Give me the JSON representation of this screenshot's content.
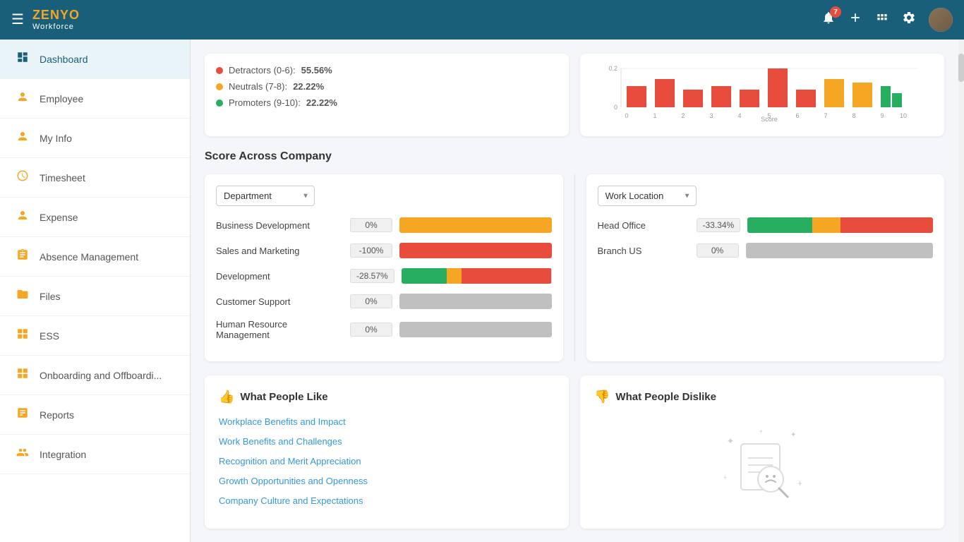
{
  "app": {
    "logo_zenyo": "ZENYO",
    "logo_workforce": "Workforce",
    "badge_count": "7"
  },
  "sidebar": {
    "items": [
      {
        "id": "dashboard",
        "label": "Dashboard",
        "icon": "⊞",
        "active": true
      },
      {
        "id": "employee",
        "label": "Employee",
        "icon": "👤",
        "active": false
      },
      {
        "id": "myinfo",
        "label": "My Info",
        "icon": "👤",
        "active": false
      },
      {
        "id": "timesheet",
        "label": "Timesheet",
        "icon": "🕐",
        "active": false
      },
      {
        "id": "expense",
        "label": "Expense",
        "icon": "👤",
        "active": false
      },
      {
        "id": "absence",
        "label": "Absence Management",
        "icon": "📋",
        "active": false
      },
      {
        "id": "files",
        "label": "Files",
        "icon": "📁",
        "active": false
      },
      {
        "id": "ess",
        "label": "ESS",
        "icon": "⊞",
        "active": false
      },
      {
        "id": "onboarding",
        "label": "Onboarding and Offboardi...",
        "icon": "⊞",
        "active": false
      },
      {
        "id": "reports",
        "label": "Reports",
        "icon": "📊",
        "active": false
      },
      {
        "id": "integration",
        "label": "Integration",
        "icon": "👥",
        "active": false
      }
    ]
  },
  "nps": {
    "detractors_label": "Detractors (0-6):",
    "detractors_value": "55.56%",
    "neutrals_label": "Neutrals (7-8):",
    "neutrals_value": "22.22%",
    "promoters_label": "Promoters (9-10):",
    "promoters_value": "22.22%"
  },
  "score_section": {
    "title": "Score Across Company",
    "dept_dropdown": "Department",
    "location_dropdown": "Work Location",
    "departments": [
      {
        "name": "Business Development",
        "pct": "0%",
        "bar_type": "orange",
        "fill": 100
      },
      {
        "name": "Sales and Marketing",
        "pct": "-100%",
        "bar_type": "red",
        "fill": 100
      },
      {
        "name": "Development",
        "pct": "-28.57%",
        "bar_type": "multi",
        "green": 30,
        "orange": 10,
        "red": 60
      },
      {
        "name": "Customer Support",
        "pct": "0%",
        "bar_type": "gray",
        "fill": 100
      },
      {
        "name": "Human Resource Management",
        "pct": "0%",
        "bar_type": "gray",
        "fill": 100
      }
    ],
    "locations": [
      {
        "name": "Head Office",
        "pct": "-33.34%",
        "bar_type": "multi",
        "green": 35,
        "orange": 15,
        "red": 50
      },
      {
        "name": "Branch US",
        "pct": "0%",
        "bar_type": "gray",
        "fill": 100
      }
    ]
  },
  "what_people_like": {
    "title": "What People Like",
    "items": [
      "Workplace Benefits and Impact",
      "Work Benefits and Challenges",
      "Recognition and Merit Appreciation",
      "Growth Opportunities and Openness",
      "Company Culture and Expectations"
    ]
  },
  "what_people_dislike": {
    "title": "What People Dislike"
  }
}
